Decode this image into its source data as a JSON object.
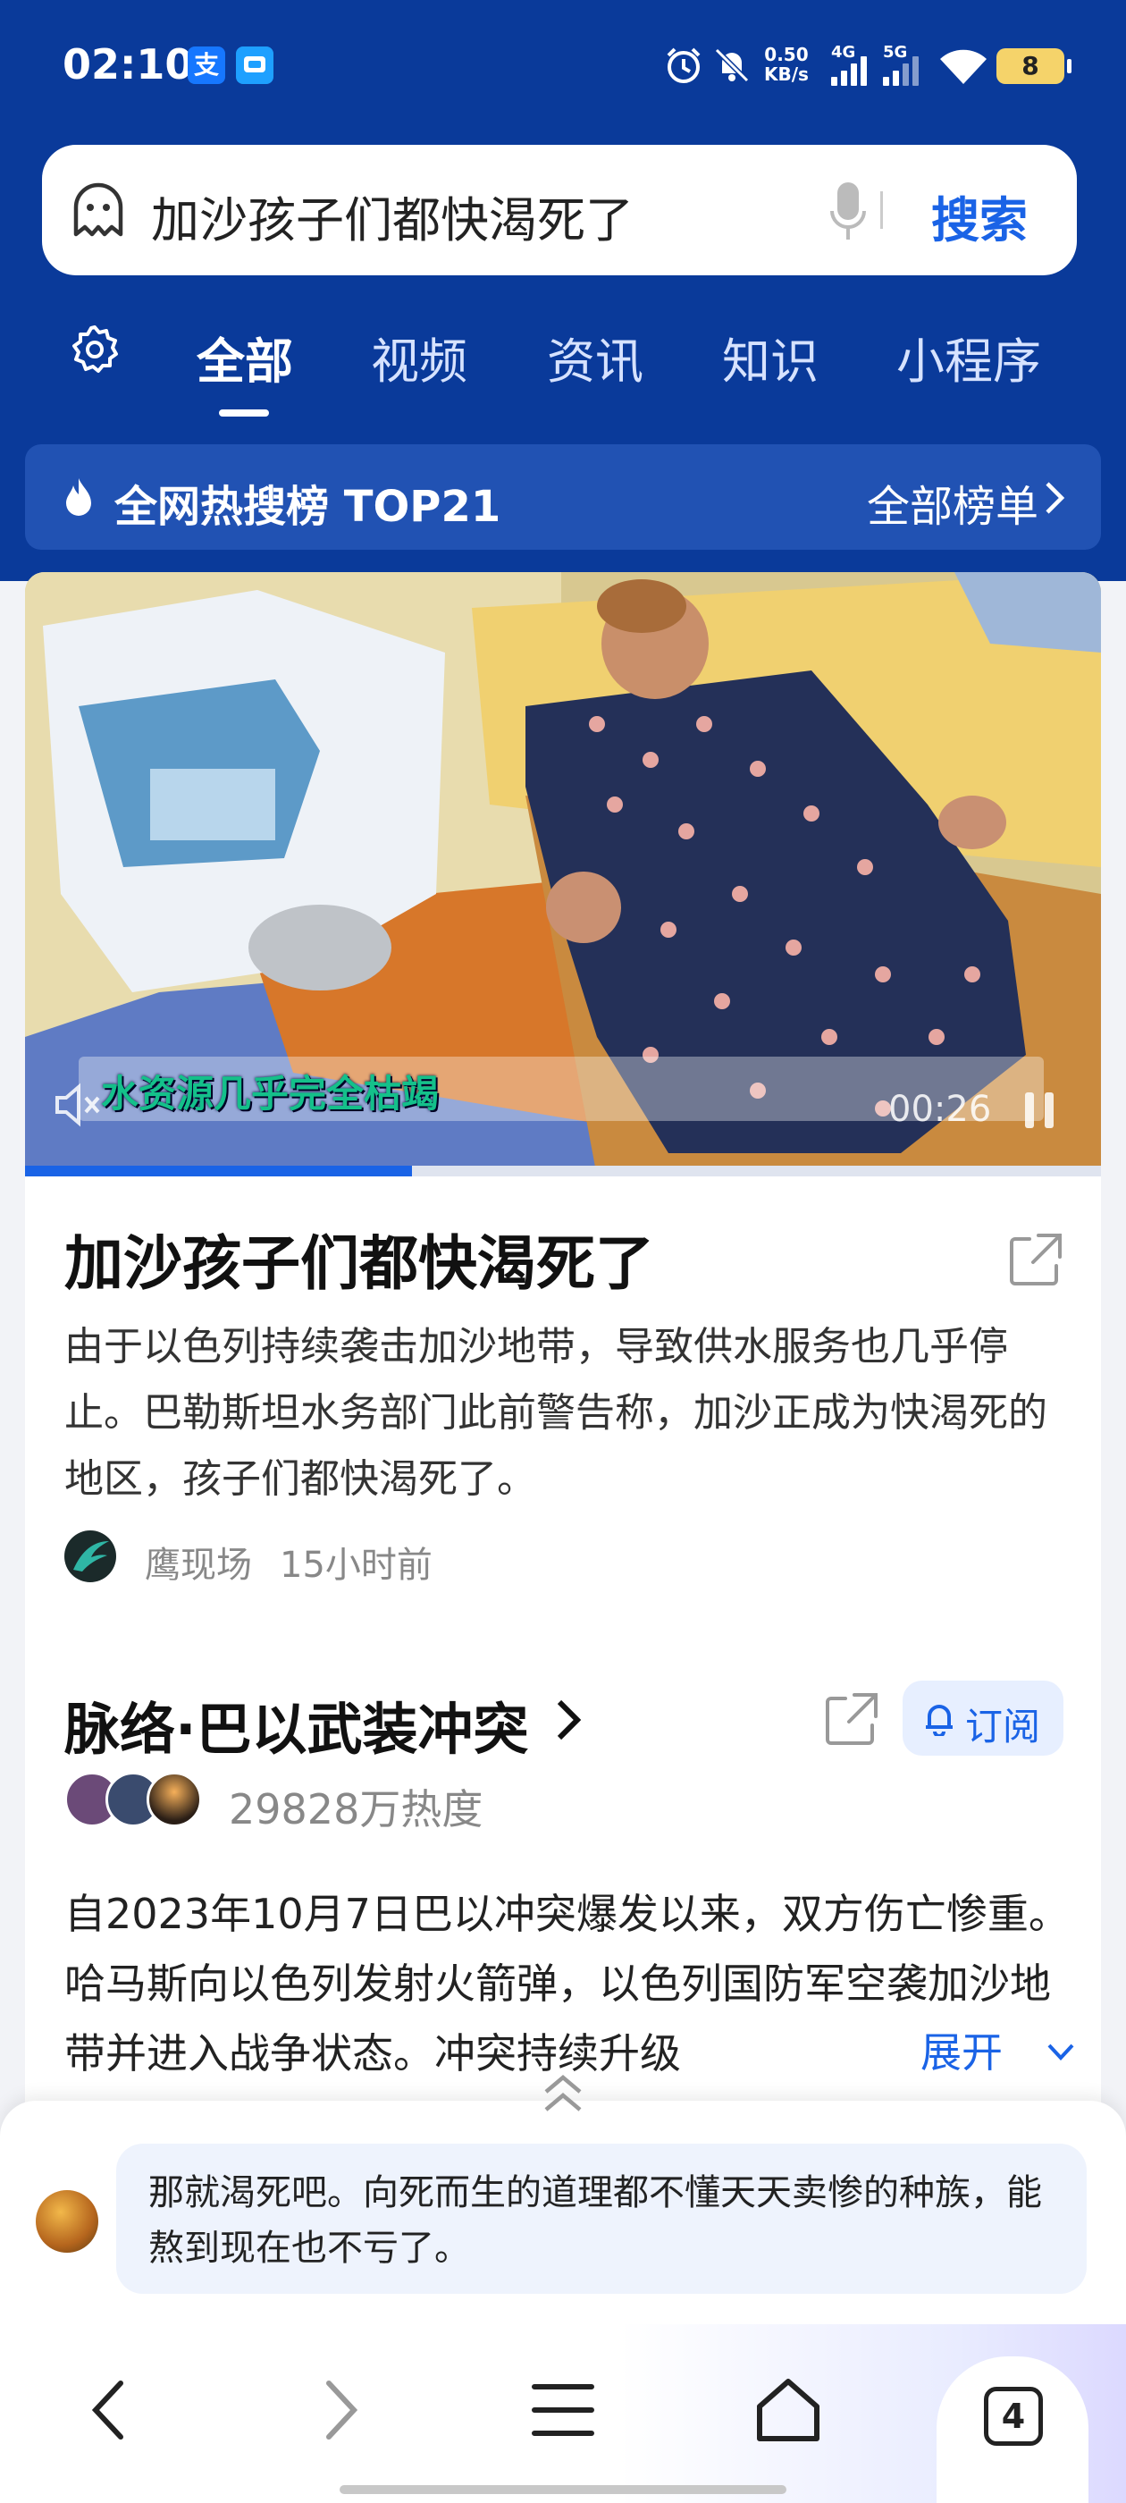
{
  "status_bar": {
    "time": "02:10",
    "net_speed_value": "0.50",
    "net_speed_unit": "KB/s",
    "sig1": "4G",
    "sig2": "5G",
    "battery": "8",
    "apps": [
      "支",
      ""
    ]
  },
  "search": {
    "query": "加沙孩子们都快渴死了",
    "button": "搜索"
  },
  "tabs": {
    "items": [
      "全部",
      "视频",
      "资讯",
      "知识",
      "小程序"
    ],
    "active": "全部"
  },
  "hot_list": {
    "title": "全网热搜榜  TOP21",
    "all_label": "全部榜单"
  },
  "video": {
    "subtitle": "水资源几乎完全枯竭",
    "duration": "00:26",
    "progress": 0.36
  },
  "news": {
    "title": "加沙孩子们都快渴死了",
    "desc": "由于以色列持续袭击加沙地带，导致供水服务也几乎停止。巴勒斯坦水务部门此前警告称，加沙正成为快渴死的地区，孩子们都快渴死了。",
    "source": "鹰现场",
    "time": "15小时前"
  },
  "topic": {
    "title": "脉络·巴以武装冲突",
    "subscribe": "订阅",
    "heat": "29828万热度",
    "desc": "自2023年10月7日巴以冲突爆发以来，双方伤亡惨重。哈马斯向以色列发射火箭弹，以色列国防军空袭加沙地带并进入战争状态。冲突持续升级",
    "expand": "展开"
  },
  "comment": {
    "text": "那就渴死吧。向死而生的道理都不懂天天卖惨的种族，能熬到现在也不亏了。"
  },
  "bottom_nav": {
    "tab_count": "4"
  },
  "colors": {
    "header_bg": "#0a3a9a",
    "accent": "#1a63e6",
    "subtitle_text": "#14c08a"
  },
  "icons": [
    "ghost-icon",
    "mic-icon",
    "gear-icon",
    "flame-icon",
    "chevron-right-icon",
    "mute-icon",
    "pause-icon",
    "share-icon",
    "bell-icon",
    "chevron-down-icon",
    "chevron-up-icon",
    "back-icon",
    "forward-icon",
    "menu-icon",
    "home-icon"
  ]
}
